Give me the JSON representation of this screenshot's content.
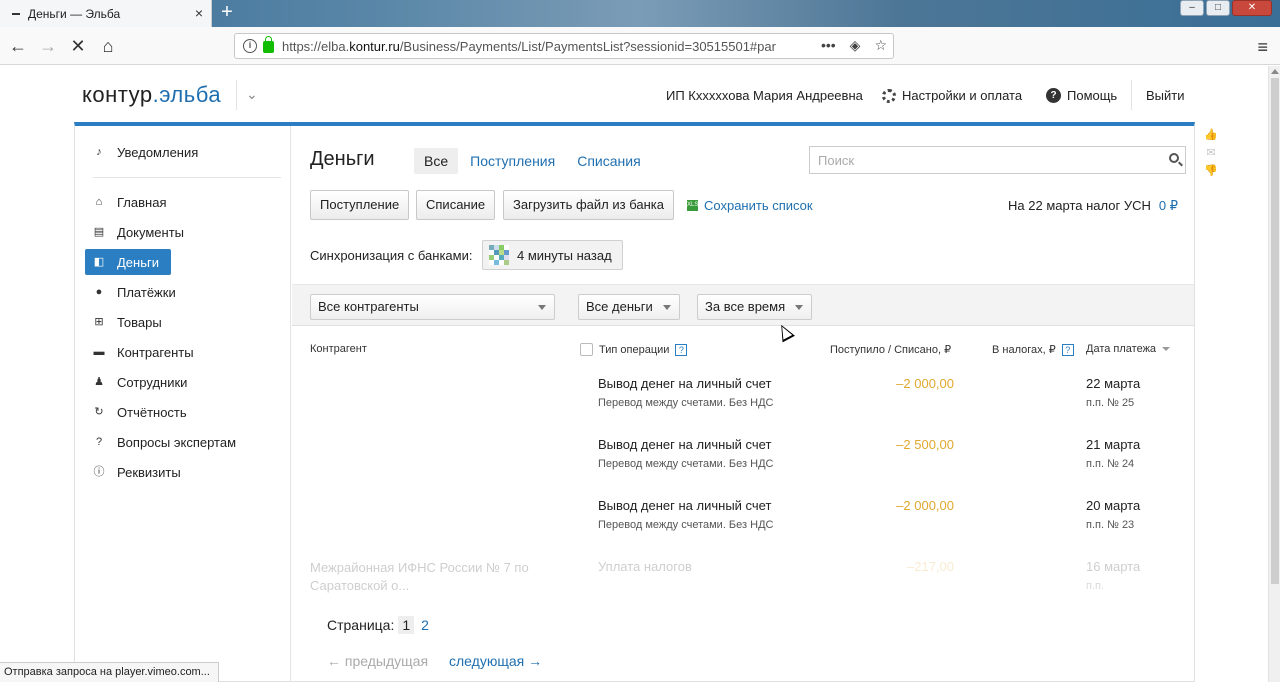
{
  "browser": {
    "tab_title": "Деньги — Эльба",
    "tab_close": "×",
    "new_tab": "+",
    "url_prefix": "https://elba.",
    "url_domain": "kontur.ru",
    "url_path": "/Business/Payments/List/PaymentsList?sessionid=30515501#par",
    "back": "←",
    "forward": "→",
    "stop": "✕",
    "home": "⌂",
    "page_actions": "•••",
    "pocket": "◈",
    "bookmark": "☆",
    "menu": "≡",
    "win_min": "–",
    "win_max": "□",
    "win_close": "✕",
    "status": "Отправка запроса на player.vimeo.com..."
  },
  "header": {
    "logo_part1": "контур",
    "logo_part2": ".эльба",
    "logo_dropdown": "⌄",
    "user": "ИП Кхххххова Мария Андреевна",
    "settings": "Настройки и оплата",
    "help_icon": "?",
    "help": "Помощь",
    "exit": "Выйти"
  },
  "sidebar": {
    "notifications": "Уведомления",
    "items": [
      {
        "label": "Главная",
        "icon": "home-icon",
        "glyph": "⌂"
      },
      {
        "label": "Документы",
        "icon": "document-icon",
        "glyph": "▤"
      },
      {
        "label": "Деньги",
        "icon": "money-icon",
        "glyph": "◧",
        "active": true
      },
      {
        "label": "Платёжки",
        "icon": "payment-icon",
        "glyph": "●"
      },
      {
        "label": "Товары",
        "icon": "cart-icon",
        "glyph": "⊞"
      },
      {
        "label": "Контрагенты",
        "icon": "briefcase-icon",
        "glyph": "▬"
      },
      {
        "label": "Сотрудники",
        "icon": "person-icon",
        "glyph": "♟"
      },
      {
        "label": "Отчётность",
        "icon": "report-icon",
        "glyph": "↻"
      },
      {
        "label": "Вопросы экспертам",
        "icon": "question-icon",
        "glyph": "?"
      },
      {
        "label": "Реквизиты",
        "icon": "requisites-icon",
        "glyph": "ⓘ"
      }
    ]
  },
  "main": {
    "title": "Деньги",
    "tabs": [
      {
        "label": "Все",
        "selected": true
      },
      {
        "label": "Поступления"
      },
      {
        "label": "Списания"
      }
    ],
    "search_placeholder": "Поиск",
    "buttons": {
      "income": "Поступление",
      "expense": "Списание",
      "upload": "Загрузить файл из банка"
    },
    "save_list": "Сохранить список",
    "xls_badge": "XLS",
    "tax_label": "На 22 марта налог УСН",
    "tax_value": "0 ₽",
    "sync_label": "Синхронизация с банками:",
    "sync_value": "4 минуты назад",
    "filters": {
      "counterparty": "Все контрагенты",
      "money": "Все деньги",
      "period": "За все время"
    },
    "columns": {
      "counterparty": "Контрагент",
      "op_type": "Тип операции",
      "amount": "Поступило / Списано, ₽",
      "taxes": "В налогах, ₽",
      "date": "Дата платежа",
      "help_icon": "?"
    },
    "rows": [
      {
        "counterparty": "",
        "op": "Вывод денег на личный счет",
        "sub": "Перевод между счетами. Без НДС",
        "amount": "–2 000,00",
        "date": "22 марта",
        "num": "п.п. № 25"
      },
      {
        "counterparty": "",
        "op": "Вывод денег на личный счет",
        "sub": "Перевод между счетами. Без НДС",
        "amount": "–2 500,00",
        "date": "21 марта",
        "num": "п.п. № 24"
      },
      {
        "counterparty": "",
        "op": "Вывод денег на личный счет",
        "sub": "Перевод между счетами. Без НДС",
        "amount": "–2 000,00",
        "date": "20 марта",
        "num": "п.п. № 23"
      },
      {
        "counterparty": "Межрайонная ИФНС России № 7 по Саратовской о...",
        "op": "Уплата налогов",
        "sub": "",
        "amount": "–217,00",
        "date": "16 марта",
        "num": "п.п."
      }
    ],
    "pager": {
      "label": "Страница:",
      "pages": [
        "1",
        "2"
      ],
      "prev": "← предыдущая",
      "next": "следующая →"
    }
  },
  "feedback": {
    "like": "👍",
    "mail": "✉",
    "dislike": "👎"
  },
  "colors": {
    "accent": "#2a7ec1",
    "link": "#1f6fb0",
    "amount_negative": "#e0a82e"
  }
}
